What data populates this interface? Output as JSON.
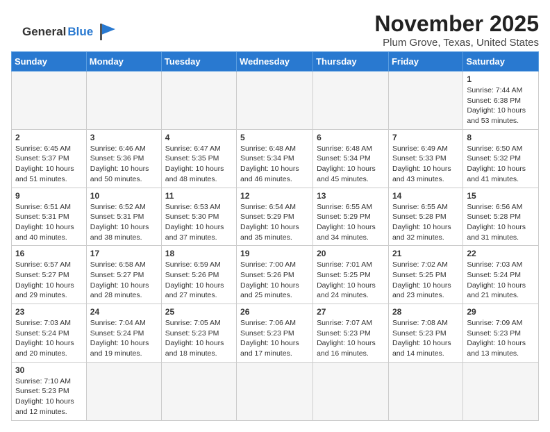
{
  "logo": {
    "text_general": "General",
    "text_blue": "Blue"
  },
  "header": {
    "month_year": "November 2025",
    "location": "Plum Grove, Texas, United States"
  },
  "days_of_week": [
    "Sunday",
    "Monday",
    "Tuesday",
    "Wednesday",
    "Thursday",
    "Friday",
    "Saturday"
  ],
  "weeks": [
    [
      {
        "day": "",
        "empty": true
      },
      {
        "day": "",
        "empty": true
      },
      {
        "day": "",
        "empty": true
      },
      {
        "day": "",
        "empty": true
      },
      {
        "day": "",
        "empty": true
      },
      {
        "day": "",
        "empty": true
      },
      {
        "day": "1",
        "sunrise": "Sunrise: 7:44 AM",
        "sunset": "Sunset: 6:38 PM",
        "daylight": "Daylight: 10 hours and 53 minutes."
      }
    ],
    [
      {
        "day": "2",
        "sunrise": "Sunrise: 6:45 AM",
        "sunset": "Sunset: 5:37 PM",
        "daylight": "Daylight: 10 hours and 51 minutes."
      },
      {
        "day": "3",
        "sunrise": "Sunrise: 6:46 AM",
        "sunset": "Sunset: 5:36 PM",
        "daylight": "Daylight: 10 hours and 50 minutes."
      },
      {
        "day": "4",
        "sunrise": "Sunrise: 6:47 AM",
        "sunset": "Sunset: 5:35 PM",
        "daylight": "Daylight: 10 hours and 48 minutes."
      },
      {
        "day": "5",
        "sunrise": "Sunrise: 6:48 AM",
        "sunset": "Sunset: 5:34 PM",
        "daylight": "Daylight: 10 hours and 46 minutes."
      },
      {
        "day": "6",
        "sunrise": "Sunrise: 6:48 AM",
        "sunset": "Sunset: 5:34 PM",
        "daylight": "Daylight: 10 hours and 45 minutes."
      },
      {
        "day": "7",
        "sunrise": "Sunrise: 6:49 AM",
        "sunset": "Sunset: 5:33 PM",
        "daylight": "Daylight: 10 hours and 43 minutes."
      },
      {
        "day": "8",
        "sunrise": "Sunrise: 6:50 AM",
        "sunset": "Sunset: 5:32 PM",
        "daylight": "Daylight: 10 hours and 41 minutes."
      }
    ],
    [
      {
        "day": "9",
        "sunrise": "Sunrise: 6:51 AM",
        "sunset": "Sunset: 5:31 PM",
        "daylight": "Daylight: 10 hours and 40 minutes."
      },
      {
        "day": "10",
        "sunrise": "Sunrise: 6:52 AM",
        "sunset": "Sunset: 5:31 PM",
        "daylight": "Daylight: 10 hours and 38 minutes."
      },
      {
        "day": "11",
        "sunrise": "Sunrise: 6:53 AM",
        "sunset": "Sunset: 5:30 PM",
        "daylight": "Daylight: 10 hours and 37 minutes."
      },
      {
        "day": "12",
        "sunrise": "Sunrise: 6:54 AM",
        "sunset": "Sunset: 5:29 PM",
        "daylight": "Daylight: 10 hours and 35 minutes."
      },
      {
        "day": "13",
        "sunrise": "Sunrise: 6:55 AM",
        "sunset": "Sunset: 5:29 PM",
        "daylight": "Daylight: 10 hours and 34 minutes."
      },
      {
        "day": "14",
        "sunrise": "Sunrise: 6:55 AM",
        "sunset": "Sunset: 5:28 PM",
        "daylight": "Daylight: 10 hours and 32 minutes."
      },
      {
        "day": "15",
        "sunrise": "Sunrise: 6:56 AM",
        "sunset": "Sunset: 5:28 PM",
        "daylight": "Daylight: 10 hours and 31 minutes."
      }
    ],
    [
      {
        "day": "16",
        "sunrise": "Sunrise: 6:57 AM",
        "sunset": "Sunset: 5:27 PM",
        "daylight": "Daylight: 10 hours and 29 minutes."
      },
      {
        "day": "17",
        "sunrise": "Sunrise: 6:58 AM",
        "sunset": "Sunset: 5:27 PM",
        "daylight": "Daylight: 10 hours and 28 minutes."
      },
      {
        "day": "18",
        "sunrise": "Sunrise: 6:59 AM",
        "sunset": "Sunset: 5:26 PM",
        "daylight": "Daylight: 10 hours and 27 minutes."
      },
      {
        "day": "19",
        "sunrise": "Sunrise: 7:00 AM",
        "sunset": "Sunset: 5:26 PM",
        "daylight": "Daylight: 10 hours and 25 minutes."
      },
      {
        "day": "20",
        "sunrise": "Sunrise: 7:01 AM",
        "sunset": "Sunset: 5:25 PM",
        "daylight": "Daylight: 10 hours and 24 minutes."
      },
      {
        "day": "21",
        "sunrise": "Sunrise: 7:02 AM",
        "sunset": "Sunset: 5:25 PM",
        "daylight": "Daylight: 10 hours and 23 minutes."
      },
      {
        "day": "22",
        "sunrise": "Sunrise: 7:03 AM",
        "sunset": "Sunset: 5:24 PM",
        "daylight": "Daylight: 10 hours and 21 minutes."
      }
    ],
    [
      {
        "day": "23",
        "sunrise": "Sunrise: 7:03 AM",
        "sunset": "Sunset: 5:24 PM",
        "daylight": "Daylight: 10 hours and 20 minutes."
      },
      {
        "day": "24",
        "sunrise": "Sunrise: 7:04 AM",
        "sunset": "Sunset: 5:24 PM",
        "daylight": "Daylight: 10 hours and 19 minutes."
      },
      {
        "day": "25",
        "sunrise": "Sunrise: 7:05 AM",
        "sunset": "Sunset: 5:23 PM",
        "daylight": "Daylight: 10 hours and 18 minutes."
      },
      {
        "day": "26",
        "sunrise": "Sunrise: 7:06 AM",
        "sunset": "Sunset: 5:23 PM",
        "daylight": "Daylight: 10 hours and 17 minutes."
      },
      {
        "day": "27",
        "sunrise": "Sunrise: 7:07 AM",
        "sunset": "Sunset: 5:23 PM",
        "daylight": "Daylight: 10 hours and 16 minutes."
      },
      {
        "day": "28",
        "sunrise": "Sunrise: 7:08 AM",
        "sunset": "Sunset: 5:23 PM",
        "daylight": "Daylight: 10 hours and 14 minutes."
      },
      {
        "day": "29",
        "sunrise": "Sunrise: 7:09 AM",
        "sunset": "Sunset: 5:23 PM",
        "daylight": "Daylight: 10 hours and 13 minutes."
      }
    ],
    [
      {
        "day": "30",
        "sunrise": "Sunrise: 7:10 AM",
        "sunset": "Sunset: 5:23 PM",
        "daylight": "Daylight: 10 hours and 12 minutes."
      },
      {
        "day": "",
        "empty": true
      },
      {
        "day": "",
        "empty": true
      },
      {
        "day": "",
        "empty": true
      },
      {
        "day": "",
        "empty": true
      },
      {
        "day": "",
        "empty": true
      },
      {
        "day": "",
        "empty": true
      }
    ]
  ]
}
